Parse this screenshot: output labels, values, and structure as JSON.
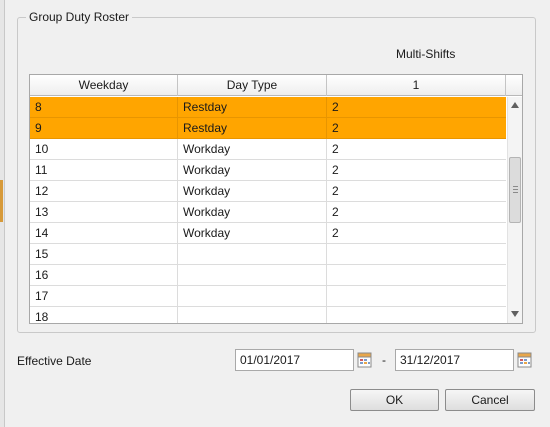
{
  "group": {
    "title": "Group Duty Roster",
    "multi_shifts_label": "Multi-Shifts"
  },
  "grid": {
    "columns": [
      "Weekday",
      "Day Type",
      "1"
    ],
    "rows": [
      {
        "weekday": "8",
        "day_type": "Restday",
        "shift": "2",
        "highlighted": true
      },
      {
        "weekday": "9",
        "day_type": "Restday",
        "shift": "2",
        "highlighted": true
      },
      {
        "weekday": "10",
        "day_type": "Workday",
        "shift": "2",
        "highlighted": false
      },
      {
        "weekday": "11",
        "day_type": "Workday",
        "shift": "2",
        "highlighted": false
      },
      {
        "weekday": "12",
        "day_type": "Workday",
        "shift": "2",
        "highlighted": false
      },
      {
        "weekday": "13",
        "day_type": "Workday",
        "shift": "2",
        "highlighted": false
      },
      {
        "weekday": "14",
        "day_type": "Workday",
        "shift": "2",
        "highlighted": false
      },
      {
        "weekday": "15",
        "day_type": "",
        "shift": "",
        "highlighted": false
      },
      {
        "weekday": "16",
        "day_type": "",
        "shift": "",
        "highlighted": false
      },
      {
        "weekday": "17",
        "day_type": "",
        "shift": "",
        "highlighted": false
      },
      {
        "weekday": "18",
        "day_type": "",
        "shift": "",
        "highlighted": false
      }
    ],
    "highlight_color": "#ffa500"
  },
  "effective": {
    "label": "Effective Date",
    "from": "01/01/2017",
    "separator": "-",
    "to": "31/12/2017"
  },
  "buttons": {
    "ok": "OK",
    "cancel": "Cancel"
  },
  "icons": {
    "calendar": "calendar-icon",
    "scroll_up": "chevron-up-icon",
    "scroll_down": "chevron-down-icon"
  }
}
